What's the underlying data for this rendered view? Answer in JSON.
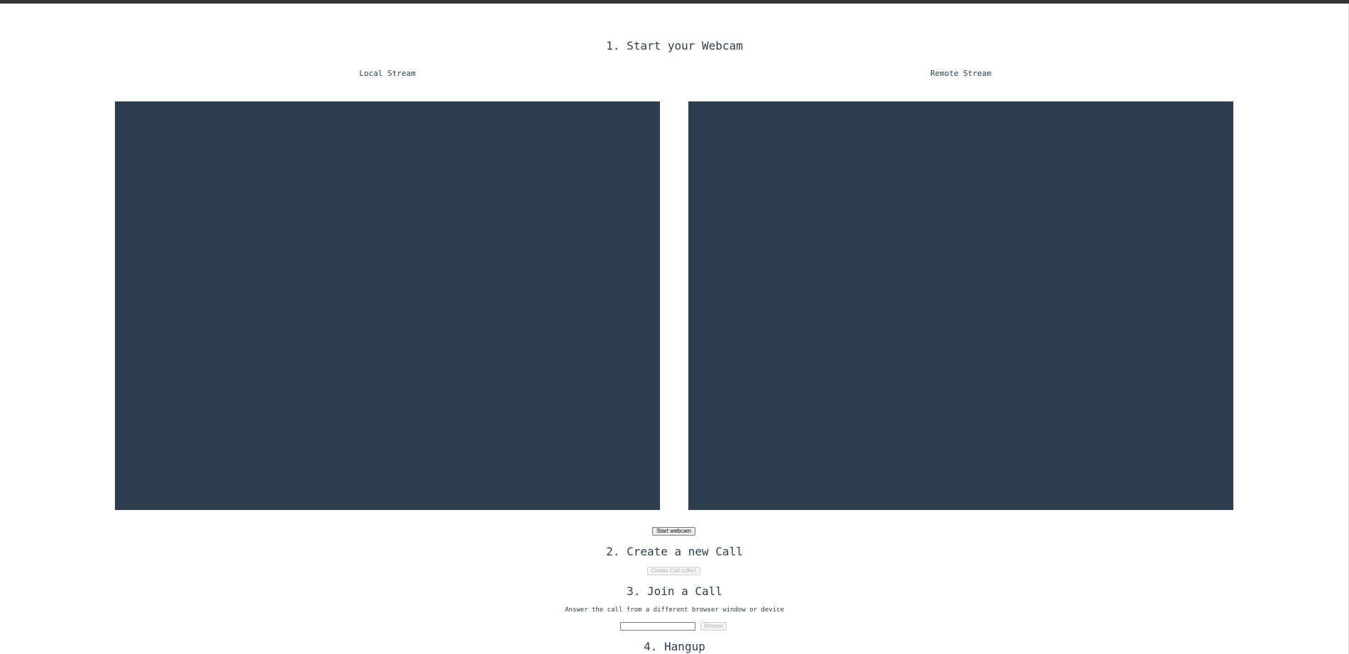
{
  "sections": {
    "start": {
      "heading": "1. Start your Webcam"
    },
    "create": {
      "heading": "2. Create a new Call"
    },
    "join": {
      "heading": "3. Join a Call",
      "hint": "Answer the call from a different browser window or device"
    },
    "hangup": {
      "heading": "4. Hangup"
    }
  },
  "streams": {
    "local": {
      "label": "Local Stream"
    },
    "remote": {
      "label": "Remote Stream"
    }
  },
  "buttons": {
    "start_webcam": "Start webcam",
    "create_call": "Create Call (offer)",
    "answer": "Answer"
  },
  "inputs": {
    "call_id": {
      "value": "",
      "placeholder": ""
    }
  },
  "colors": {
    "video_background": "#2c3e50",
    "text": "#2c3e50",
    "top_bar": "#333333"
  }
}
